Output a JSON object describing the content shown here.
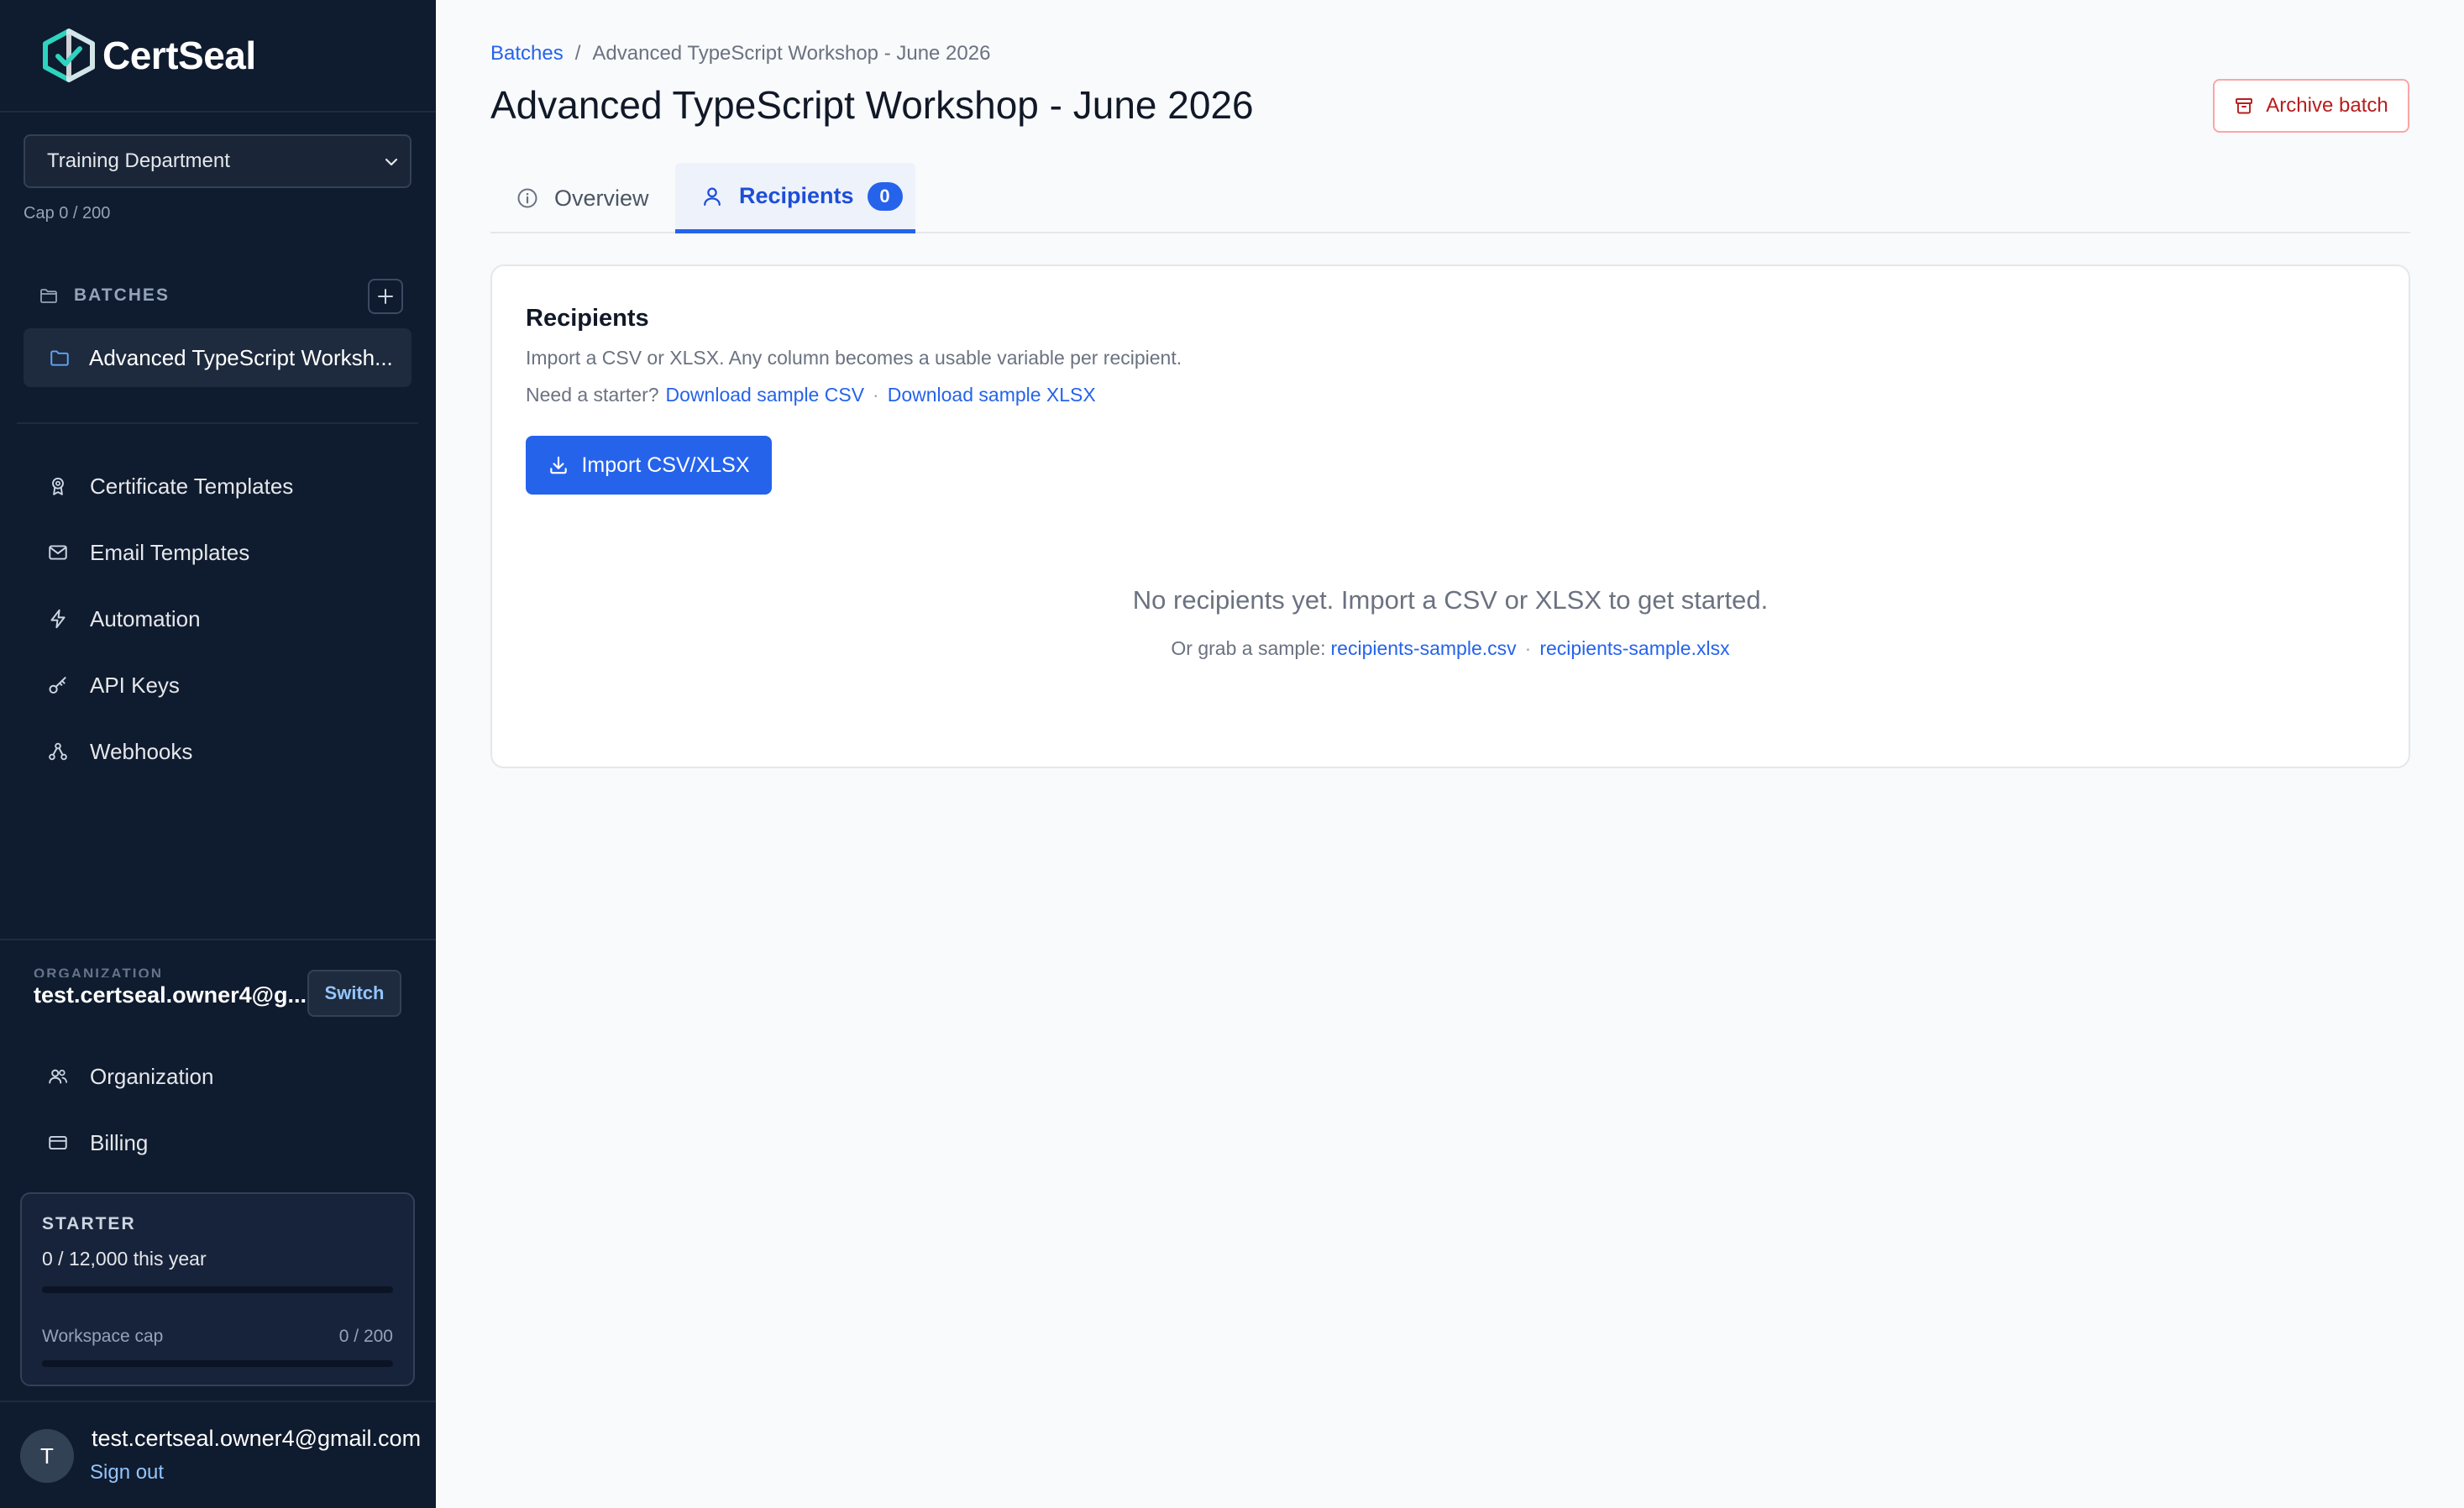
{
  "app": {
    "name": "CertSeal"
  },
  "workspace": {
    "selected": "Training Department",
    "cap_text": "Cap 0 / 200"
  },
  "sidebar": {
    "batches_header": "BATCHES",
    "batch_items": [
      {
        "label": "Advanced TypeScript Worksh..."
      }
    ],
    "nav": [
      {
        "label": "Certificate Templates",
        "icon": "award-icon"
      },
      {
        "label": "Email Templates",
        "icon": "mail-icon"
      },
      {
        "label": "Automation",
        "icon": "lightning-icon"
      },
      {
        "label": "API Keys",
        "icon": "key-icon"
      },
      {
        "label": "Webhooks",
        "icon": "webhook-icon"
      }
    ],
    "organization_label": "ORGANIZATION",
    "organization_name": "test.certseal.owner4@g...",
    "switch_label": "Switch",
    "org_nav": [
      {
        "label": "Organization",
        "icon": "users-icon"
      },
      {
        "label": "Billing",
        "icon": "credit-card-icon"
      }
    ],
    "plan": {
      "name": "STARTER",
      "usage_text": "0 / 12,000 this year",
      "usage_fraction": 0,
      "workspace_cap_label": "Workspace cap",
      "workspace_cap_value": "0 / 200",
      "workspace_cap_fraction": 0
    },
    "user": {
      "avatar_initial": "T",
      "email": "test.certseal.owner4@gmail.com",
      "sign_out_label": "Sign out"
    }
  },
  "breadcrumb": {
    "root": "Batches",
    "separator": "/",
    "current": "Advanced TypeScript Workshop - June 2026"
  },
  "page": {
    "title": "Advanced TypeScript Workshop - June 2026",
    "archive_label": "Archive batch"
  },
  "tabs": {
    "overview": {
      "label": "Overview"
    },
    "recipients": {
      "label": "Recipients",
      "count": "0"
    }
  },
  "recipients_card": {
    "title": "Recipients",
    "description": "Import a CSV or XLSX. Any column becomes a usable variable per recipient.",
    "starter_prefix": "Need a starter?",
    "sample_csv_link": "Download sample CSV",
    "separator": "·",
    "sample_xlsx_link": "Download sample XLSX",
    "import_button": "Import CSV/XLSX",
    "empty_title": "No recipients yet. Import a CSV or XLSX to get started.",
    "empty_prefix": "Or grab a sample:",
    "empty_csv_link": "recipients-sample.csv",
    "empty_xlsx_link": "recipients-sample.xlsx"
  },
  "colors": {
    "sidebar_bg": "#0f1b2e",
    "accent": "#2563eb",
    "danger": "#b91c1c",
    "logo_teal": "#2dd4bf"
  }
}
